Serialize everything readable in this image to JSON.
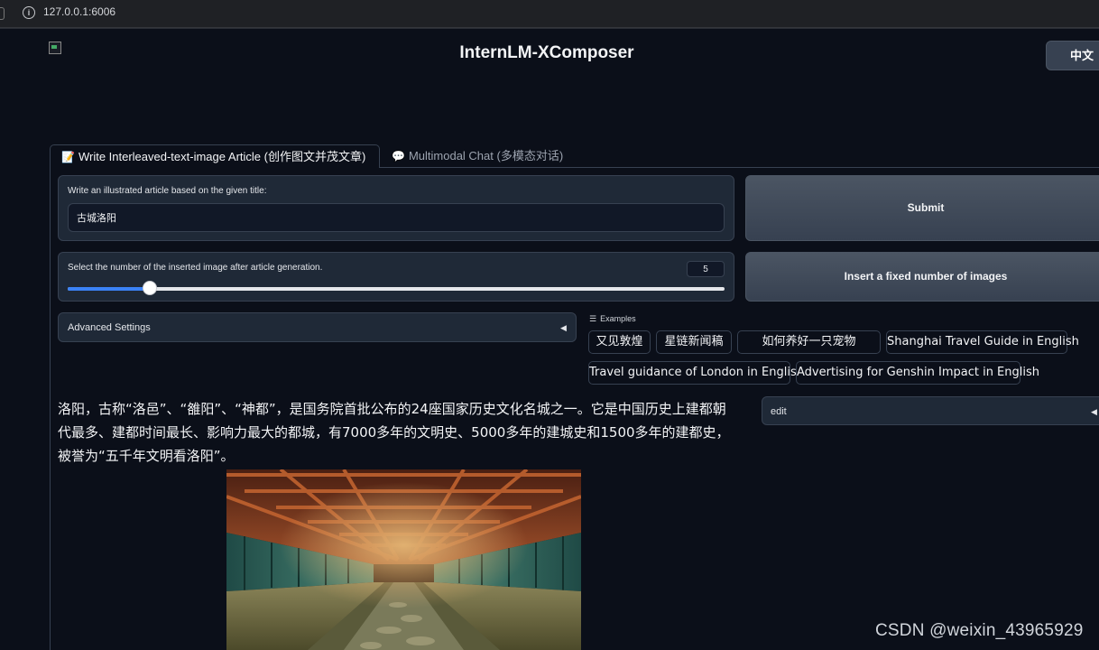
{
  "browser": {
    "url": "127.0.0.1:6006"
  },
  "header": {
    "title": "InternLM-XComposer",
    "lang_button": "中文"
  },
  "tabs": [
    {
      "icon": "📝",
      "label": "Write Interleaved-text-image Article (创作图文并茂文章)",
      "active": true
    },
    {
      "icon": "💬",
      "label": "Multimodal Chat (多模态对话)",
      "active": false
    }
  ],
  "form": {
    "title_label": "Write an illustrated article based on the given title:",
    "title_value": "古城洛阳",
    "image_count_label": "Select the number of the inserted image after article generation.",
    "image_count_value": "5",
    "image_count_fraction": 0.125,
    "submit_label": "Submit",
    "insert_label": "Insert a fixed number of images",
    "advanced_label": "Advanced Settings",
    "edit_label": "edit"
  },
  "examples": {
    "label": "Examples",
    "items": [
      "又见敦煌",
      "星链新闻稿",
      "如何养好一只宠物",
      "Shanghai Travel Guide in English",
      "Travel guidance of London in English",
      "Advertising for Genshin Impact in English"
    ]
  },
  "article": {
    "lines": [
      "洛阳，古称“洛邑”、“雒阳”、“神都”，是国务院首批公布的24座国家历史文化名城之一。它是中国历史上建都朝",
      "代最多、建都时间最长、影响力最大的都城，有7000多年的文明史、5000多年的建城史和1500多年的建都史，",
      "被誉为“五千年文明看洛阳”。"
    ]
  },
  "watermark": "CSDN @weixin_43965929",
  "colors": {
    "background": "#0b0f19",
    "block": "#1f2937",
    "border": "#374151",
    "accent": "#3b82f6"
  }
}
